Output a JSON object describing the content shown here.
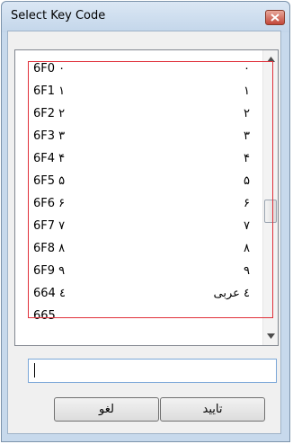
{
  "window": {
    "title": "Select Key Code"
  },
  "list": {
    "rows": [
      {
        "code": "6F0 ۰",
        "glyph": "۰"
      },
      {
        "code": "6F1 ۱",
        "glyph": "۱"
      },
      {
        "code": "6F2 ۲",
        "glyph": "۲"
      },
      {
        "code": "6F3 ۳",
        "glyph": "۳"
      },
      {
        "code": "6F4 ۴",
        "glyph": "۴"
      },
      {
        "code": "6F5 ۵",
        "glyph": "۵"
      },
      {
        "code": "6F6 ۶",
        "glyph": "۶"
      },
      {
        "code": "6F7 ۷",
        "glyph": "۷"
      },
      {
        "code": "6F8 ۸",
        "glyph": "۸"
      },
      {
        "code": "6F9 ۹",
        "glyph": "۹"
      },
      {
        "code": "664 ٤",
        "glyph": "٤ عربی"
      },
      {
        "code": "665",
        "glyph": ""
      }
    ]
  },
  "input": {
    "value": ""
  },
  "buttons": {
    "cancel_label": "لغو",
    "ok_label": "تایید"
  },
  "icons": {
    "close": "close-icon",
    "scroll_up": "chevron-up-icon",
    "scroll_down": "chevron-down-icon"
  },
  "colors": {
    "highlight_border": "#e0303a",
    "close_button": "#c2473a",
    "input_border": "#7aa7d8"
  }
}
